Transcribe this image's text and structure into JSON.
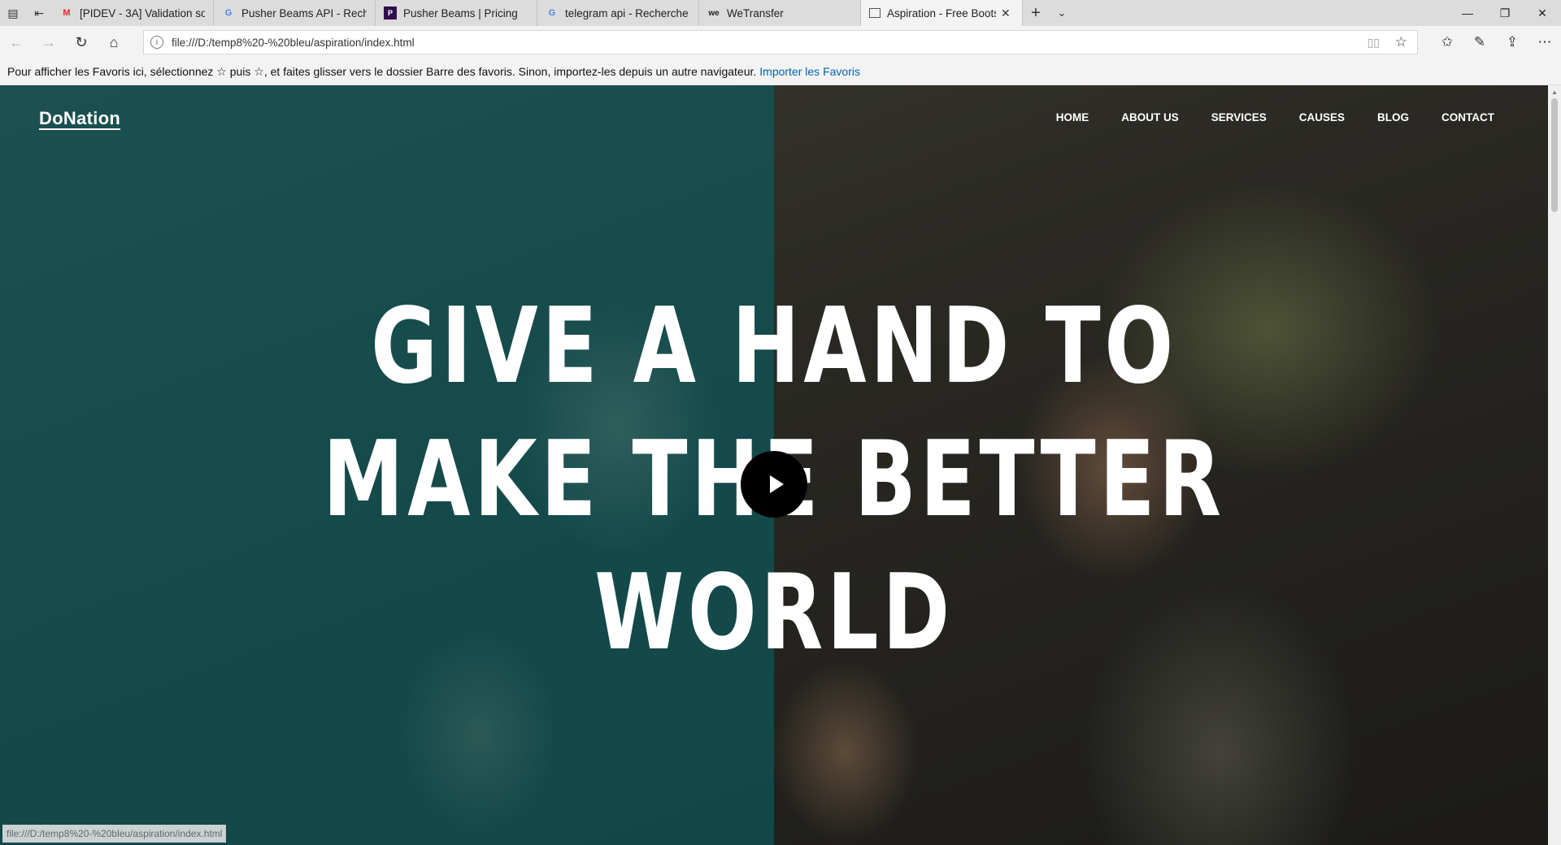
{
  "browser": {
    "tabs": [
      {
        "title": "[PIDEV - 3A] Validation soft",
        "favicon": "gmail-icon",
        "active": false
      },
      {
        "title": "Pusher Beams API - Recherc",
        "favicon": "google-icon",
        "active": false
      },
      {
        "title": "Pusher Beams | Pricing",
        "favicon": "pusher-icon",
        "active": false
      },
      {
        "title": "telegram api - Recherche Gc",
        "favicon": "google-icon",
        "active": false
      },
      {
        "title": "WeTransfer",
        "favicon": "wetransfer-icon",
        "active": false
      },
      {
        "title": "Aspiration - Free Bootst",
        "favicon": "page-icon",
        "active": true
      }
    ],
    "address": "file:///D:/temp8%20-%20bleu/aspiration/index.html",
    "favorites_bar": {
      "message": "Pour afficher les Favoris ici, sélectionnez  ☆  puis ☆, et faites glisser vers le dossier Barre des favoris. Sinon, importez-les depuis un autre navigateur.",
      "import_link": "Importer les Favoris"
    },
    "status_url": "file:///D:/temp8%20-%20bleu/aspiration/index.html"
  },
  "site": {
    "brand": "DoNation",
    "menu": [
      "HOME",
      "ABOUT US",
      "SERVICES",
      "CAUSES",
      "BLOG",
      "CONTACT"
    ],
    "hero_lines": [
      "GIVE A HAND TO",
      "MAKE THE BETTER",
      "WORLD"
    ],
    "tint_color": "#0a5f64"
  }
}
